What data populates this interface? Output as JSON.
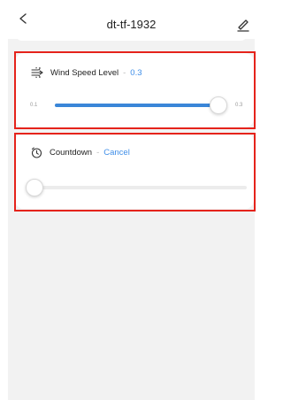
{
  "header": {
    "back_icon": "chevron-left-icon",
    "title": "dt-tf-1932",
    "edit_icon": "pencil-icon"
  },
  "wind_speed": {
    "icon": "wind-icon",
    "label": "Wind Speed Level",
    "separator": "-",
    "value": "0.3",
    "min_label": "0.1",
    "max_label": "0.3",
    "level": 1.0
  },
  "countdown": {
    "icon": "timer-icon",
    "label": "Countdown",
    "separator": "-",
    "action": "Cancel",
    "level": 0.0
  },
  "colors": {
    "accent": "#3a86d8",
    "highlight": "#e5231b",
    "background": "#f2f2f2"
  }
}
